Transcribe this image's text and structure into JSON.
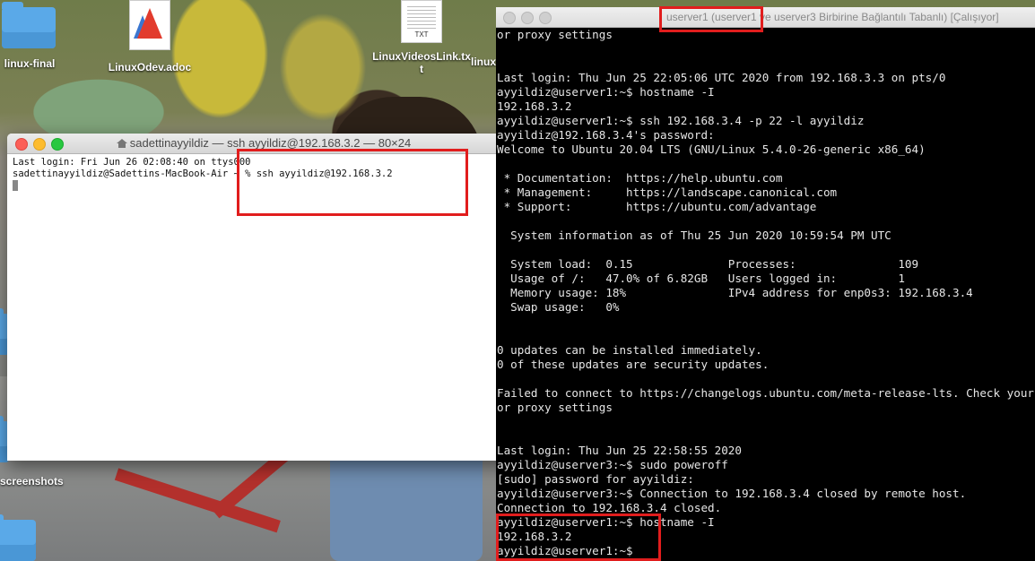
{
  "desktop": {
    "icons": [
      {
        "label": "linux-final",
        "type": "folder"
      },
      {
        "label": "LinuxOdev.adoc",
        "type": "adoc"
      },
      {
        "label": "LinuxVideosLink.txt",
        "type": "txt",
        "badge": "TXT"
      },
      {
        "label": "linux",
        "type": "text"
      },
      {
        "label": "screenshots",
        "type": "folder"
      }
    ]
  },
  "mac_terminal": {
    "title": "sadettinayyildiz — ssh ayyildiz@192.168.3.2 — 80×24",
    "lines": [
      "Last login: Fri Jun 26 02:08:40 on ttys000",
      "sadettinayyildiz@Sadettins-MacBook-Air ~ % ssh ayyildiz@192.168.3.2"
    ]
  },
  "vm_console": {
    "title": "userver1 (userver1 ve userver3 Birbirine Bağlantılı Tabanlı) [Çalışıyor]",
    "lines": [
      "or proxy settings",
      "",
      "",
      "Last login: Thu Jun 25 22:05:06 UTC 2020 from 192.168.3.3 on pts/0",
      "ayyildiz@userver1:~$ hostname -I",
      "192.168.3.2",
      "ayyildiz@userver1:~$ ssh 192.168.3.4 -p 22 -l ayyildiz",
      "ayyildiz@192.168.3.4's password:",
      "Welcome to Ubuntu 20.04 LTS (GNU/Linux 5.4.0-26-generic x86_64)",
      "",
      " * Documentation:  https://help.ubuntu.com",
      " * Management:     https://landscape.canonical.com",
      " * Support:        https://ubuntu.com/advantage",
      "",
      "  System information as of Thu 25 Jun 2020 10:59:54 PM UTC",
      "",
      "  System load:  0.15              Processes:               109",
      "  Usage of /:   47.0% of 6.82GB   Users logged in:         1",
      "  Memory usage: 18%               IPv4 address for enp0s3: 192.168.3.4",
      "  Swap usage:   0%",
      "",
      "",
      "0 updates can be installed immediately.",
      "0 of these updates are security updates.",
      "",
      "Failed to connect to https://changelogs.ubuntu.com/meta-release-lts. Check your Internet connection",
      "or proxy settings",
      "",
      "",
      "Last login: Thu Jun 25 22:58:55 2020",
      "ayyildiz@userver3:~$ sudo poweroff",
      "[sudo] password for ayyildiz:",
      "ayyildiz@userver3:~$ Connection to 192.168.3.4 closed by remote host.",
      "Connection to 192.168.3.4 closed.",
      "ayyildiz@userver1:~$ hostname -I",
      "192.168.3.2",
      "ayyildiz@userver1:~$ "
    ]
  },
  "highlight_color": "#e11d1d"
}
